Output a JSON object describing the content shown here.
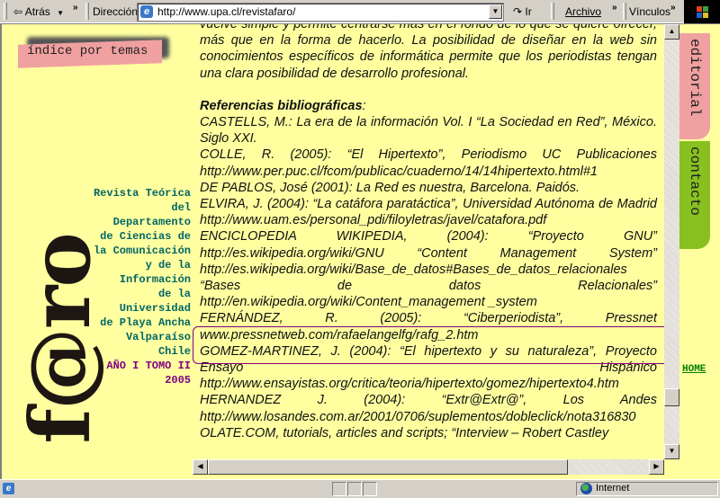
{
  "browser": {
    "toolbar": {
      "back_label": "Atrás",
      "more_chevron": "»",
      "address_label": "Dirección",
      "address_value": "http://www.upa.cl/revistafaro/",
      "go_label": "Ir",
      "menu_archivo": "Archivo",
      "links_label": "Vínculos"
    },
    "statusbar": {
      "zone_label": "Internet"
    }
  },
  "site": {
    "index_tab": "índice por temas",
    "logo": "f@ro",
    "info_lines": [
      "Revista Teórica",
      "del",
      "Departamento",
      "de Ciencias de",
      "la Comunicación",
      "y de la",
      "Información",
      "de la",
      "Universidad",
      "de Playa Ancha",
      "Valparaíso",
      "Chile"
    ],
    "issue": "AÑO I TOMO II",
    "year": "2005",
    "right_tabs": {
      "editorial": "editorial",
      "contacto": "contacto",
      "home": "HOME"
    },
    "colors": {
      "page_bg": "#ffffa0",
      "editorial_tab": "#f0a0a0",
      "contacto_tab": "#88c020",
      "info_text": "#006666",
      "issue_text": "#800080",
      "home_link": "#008000"
    }
  },
  "article": {
    "paragraph": "vuelve simple y permite centrarse más en el fondo de lo que se quiere ofrecer, más que en la forma de hacerlo. La posibilidad de diseñar en la web sin conocimientos específicos de informática permite que los periodistas tengan una clara posibilidad de desarrollo profesional.",
    "references_heading": "Referencias bibliográficas",
    "references_colon": ":",
    "references": [
      "CASTELLS, M.: La era de la información Vol. I “La Sociedad en Red”, México. Siglo XXI.",
      "COLLE, R. (2005): “El Hipertexto”, Periodismo UC Publicaciones http://www.per.puc.cl/fcom/publicac/cuaderno/14/14hipertexto.html#1",
      "DE PABLOS, José (2001): La Red es nuestra, Barcelona. Paidós.",
      "ELVIRA, J. (2004): “La catáfora paratáctica”, Universidad Autónoma de Madrid http://www.uam.es/personal_pdi/filoyletras/javel/catafora.pdf",
      "ENCICLOPEDIA WIKIPEDIA, (2004): “Proyecto GNU” http://es.wikipedia.org/wiki/GNU “Content Management System” http://es.wikipedia.org/wiki/Base_de_datos#Bases_de_datos_relacionales “Bases de datos Relacionales” http://en.wikipedia.org/wiki/Content_management _system",
      "FERNÁNDEZ, R. (2005): “Ciberperiodista”, Pressnet www.pressnetweb.com/rafaelangelfg/rafg_2.htm",
      "GOMEZ-MARTINEZ, J. (2004): “El hipertexto y su naturaleza”, Proyecto Ensayo Hispánico http://www.ensayistas.org/critica/teoria/hipertexto/gomez/hipertexto4.htm",
      "HERNANDEZ J. (2004): “Extr@Extr@”, Los Andes http://www.losandes.com.ar/2001/0706/suplementos/dobleclick/nota316830",
      "OLATE.COM, tutorials, articles and scripts; “Interview – Robert Castley"
    ]
  }
}
